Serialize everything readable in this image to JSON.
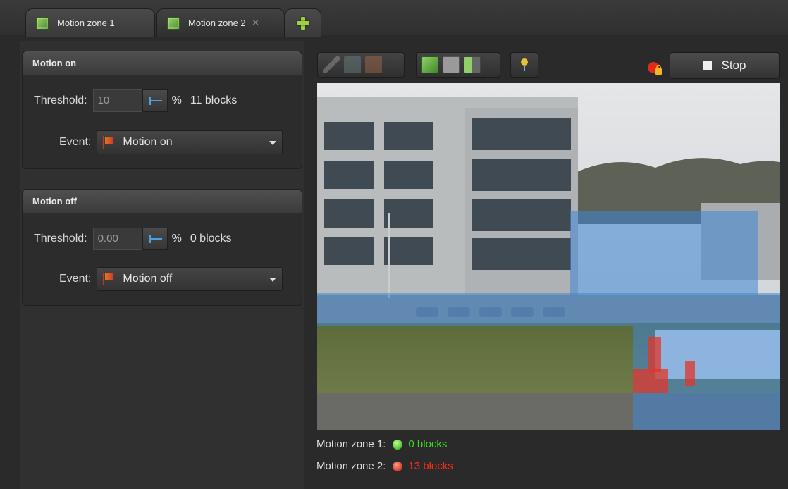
{
  "tabs": [
    {
      "label": "Motion zone 1",
      "active": false
    },
    {
      "label": "Motion zone 2",
      "active": true,
      "closable": true
    }
  ],
  "add_tab_icon": "plus-icon",
  "motion_on": {
    "header": "Motion on",
    "threshold_label": "Threshold:",
    "threshold_value": "10",
    "unit": "%",
    "blocks": "11 blocks",
    "event_label": "Event:",
    "event_value": "Motion on"
  },
  "motion_off": {
    "header": "Motion off",
    "threshold_label": "Threshold:",
    "threshold_value": "0.00",
    "unit": "%",
    "blocks": "0 blocks",
    "event_label": "Event:",
    "event_value": "Motion off"
  },
  "toolbar": {
    "stop_label": "Stop"
  },
  "status": [
    {
      "label": "Motion zone 1:",
      "value": "0 blocks",
      "color": "#3ddc1f",
      "indicator": "green"
    },
    {
      "label": "Motion zone 2:",
      "value": "13 blocks",
      "color": "#ff2a1a",
      "indicator": "red"
    }
  ],
  "colors": {
    "zone_blue": "#3f86d6",
    "zone_red": "#e0352a",
    "accent_green": "#9cd23c"
  }
}
